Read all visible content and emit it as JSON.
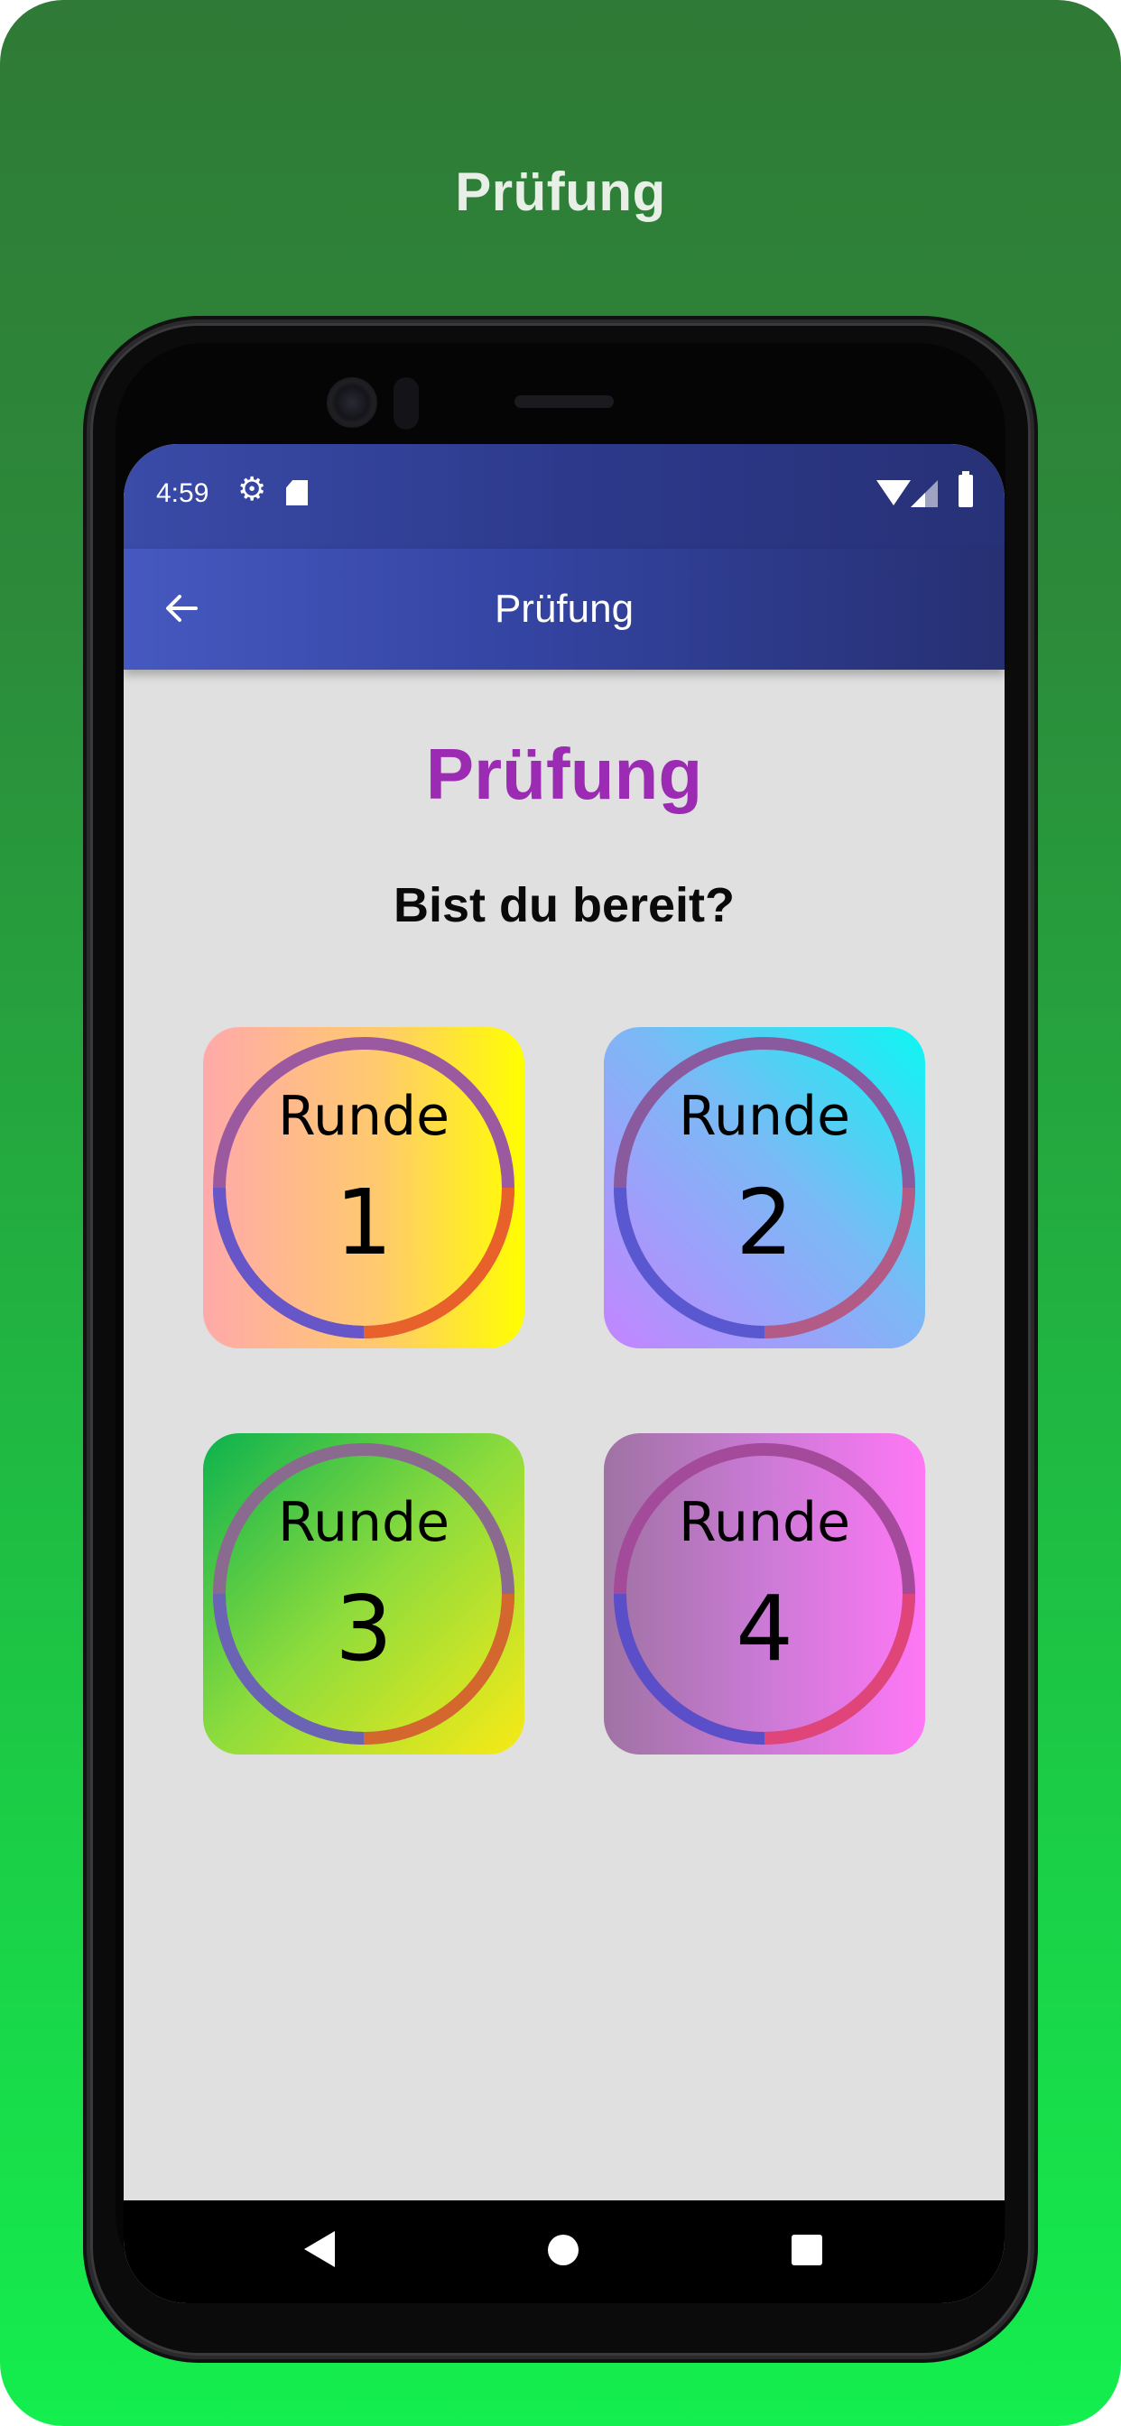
{
  "promo": {
    "title": "Prüfung"
  },
  "status_bar": {
    "time": "4:59",
    "icons": [
      "gear-icon",
      "sd-card-icon",
      "wifi-icon",
      "signal-icon",
      "battery-icon"
    ]
  },
  "app_bar": {
    "title": "Prüfung",
    "back_icon": "back-arrow-icon",
    "background_colors": [
      "#4659c0",
      "#263072"
    ]
  },
  "content": {
    "title": "Prüfung",
    "title_color": "#9b2bb3",
    "subtitle": "Bist du bereit?"
  },
  "rounds": [
    {
      "label": "Runde",
      "number": "1",
      "progress": 0.5
    },
    {
      "label": "Runde",
      "number": "2",
      "progress": 0.5
    },
    {
      "label": "Runde",
      "number": "3",
      "progress": 0.5
    },
    {
      "label": "Runde",
      "number": "4",
      "progress": 0.5
    }
  ],
  "nav_bar": {
    "icons": [
      "nav-back-icon",
      "nav-home-icon",
      "nav-recent-apps-icon"
    ]
  },
  "colors": {
    "background_top": "#2f7a36",
    "background_bottom": "#14ee4e",
    "screen_background": "#e0e0e0"
  }
}
